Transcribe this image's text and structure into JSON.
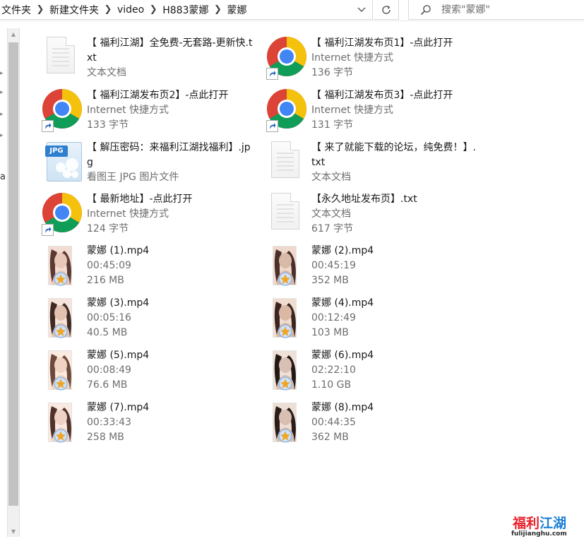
{
  "addressbar": {
    "crumbs": [
      "文件夹",
      "新建文件夹",
      "video",
      "H883蒙娜",
      "蒙娜"
    ]
  },
  "search": {
    "placeholder": "搜索\"蒙娜\""
  },
  "nav": {
    "fragment": "a"
  },
  "files": [
    {
      "name": "【 福利江湖】全免费-无套路-更新快.txt",
      "sub1": "文本文档",
      "sub2": "",
      "type": "txt"
    },
    {
      "name": "【 福利江湖发布页1】-点此打开",
      "sub1": "Internet 快捷方式",
      "sub2": "136 字节",
      "type": "url"
    },
    {
      "name": "【 福利江湖发布页2】-点此打开",
      "sub1": "Internet 快捷方式",
      "sub2": "133 字节",
      "type": "url"
    },
    {
      "name": "【 福利江湖发布页3】-点此打开",
      "sub1": "Internet 快捷方式",
      "sub2": "131 字节",
      "type": "url"
    },
    {
      "name": "【 解压密码：来福利江湖找福利】.jpg",
      "sub1": "看图王 JPG 图片文件",
      "sub2": "",
      "type": "jpg"
    },
    {
      "name": "【 来了就能下载的论坛，纯免费！】.txt",
      "sub1": "文本文档",
      "sub2": "",
      "type": "txt"
    },
    {
      "name": "【 最新地址】-点此打开",
      "sub1": "Internet 快捷方式",
      "sub2": "124 字节",
      "type": "url"
    },
    {
      "name": "【永久地址发布页】.txt",
      "sub1": "文本文档",
      "sub2": "617 字节",
      "type": "txt"
    },
    {
      "name": "蒙娜 (1).mp4",
      "sub1": "00:45:09",
      "sub2": "216 MB",
      "type": "mp4"
    },
    {
      "name": "蒙娜 (2).mp4",
      "sub1": "00:45:19",
      "sub2": "352 MB",
      "type": "mp4"
    },
    {
      "name": "蒙娜 (3).mp4",
      "sub1": "00:05:16",
      "sub2": "40.5 MB",
      "type": "mp4"
    },
    {
      "name": "蒙娜 (4).mp4",
      "sub1": "00:12:49",
      "sub2": "103 MB",
      "type": "mp4"
    },
    {
      "name": "蒙娜 (5).mp4",
      "sub1": "00:08:49",
      "sub2": "76.6 MB",
      "type": "mp4"
    },
    {
      "name": "蒙娜 (6).mp4",
      "sub1": "02:22:10",
      "sub2": "1.10 GB",
      "type": "mp4"
    },
    {
      "name": "蒙娜 (7).mp4",
      "sub1": "00:33:43",
      "sub2": "258 MB",
      "type": "mp4"
    },
    {
      "name": "蒙娜 (8).mp4",
      "sub1": "00:44:35",
      "sub2": "362 MB",
      "type": "mp4"
    }
  ],
  "watermark": {
    "brand_a": "福利",
    "brand_b": "江湖",
    "url": "fulijianghu.com"
  },
  "icons": {
    "txt": "text-document-icon",
    "url": "chrome-shortcut-icon",
    "jpg": "jpg-image-icon",
    "mp4": "video-thumbnail-icon"
  }
}
